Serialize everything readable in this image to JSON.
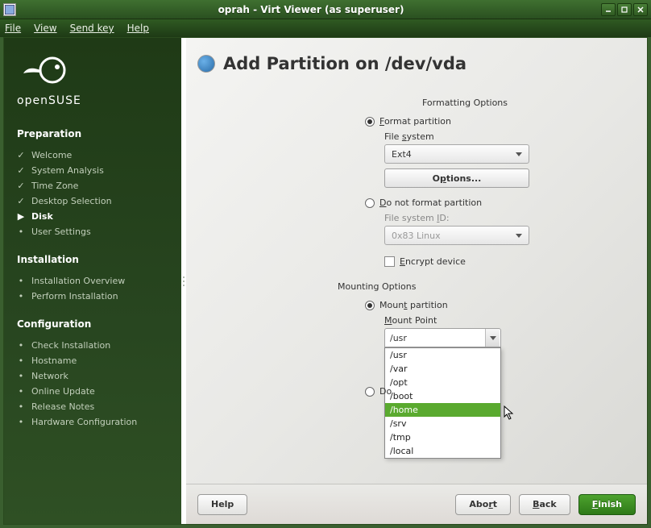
{
  "titlebar": {
    "title": "oprah - Virt Viewer (as superuser)"
  },
  "menubar": {
    "file": "File",
    "view": "View",
    "sendkey": "Send key",
    "help": "Help"
  },
  "brand": {
    "name": "openSUSE"
  },
  "sidebar": {
    "preparation": {
      "heading": "Preparation",
      "items": [
        "Welcome",
        "System Analysis",
        "Time Zone",
        "Desktop Selection",
        "Disk",
        "User Settings"
      ]
    },
    "installation": {
      "heading": "Installation",
      "items": [
        "Installation Overview",
        "Perform Installation"
      ]
    },
    "configuration": {
      "heading": "Configuration",
      "items": [
        "Check Installation",
        "Hostname",
        "Network",
        "Online Update",
        "Release Notes",
        "Hardware Configuration"
      ]
    }
  },
  "page": {
    "title": "Add Partition on /dev/vda"
  },
  "format": {
    "section": "Formatting Options",
    "format_radio": "Format partition",
    "fs_label": "File system",
    "fs_value": "Ext4",
    "options_btn": "Options...",
    "noformat_radio": "Do not format partition",
    "fsid_label": "File system ID:",
    "fsid_value": "0x83 Linux",
    "encrypt": "Encrypt device"
  },
  "mount": {
    "section": "Mounting Options",
    "mount_radio": "Mount partition",
    "point_label": "Mount Point",
    "point_value": "/usr",
    "nomount_radio": "Do",
    "options": [
      "/usr",
      "/var",
      "/opt",
      "/boot",
      "/home",
      "/srv",
      "/tmp",
      "/local"
    ]
  },
  "footer": {
    "help": "Help",
    "abort": "Abort",
    "back": "Back",
    "finish": "Finish"
  }
}
